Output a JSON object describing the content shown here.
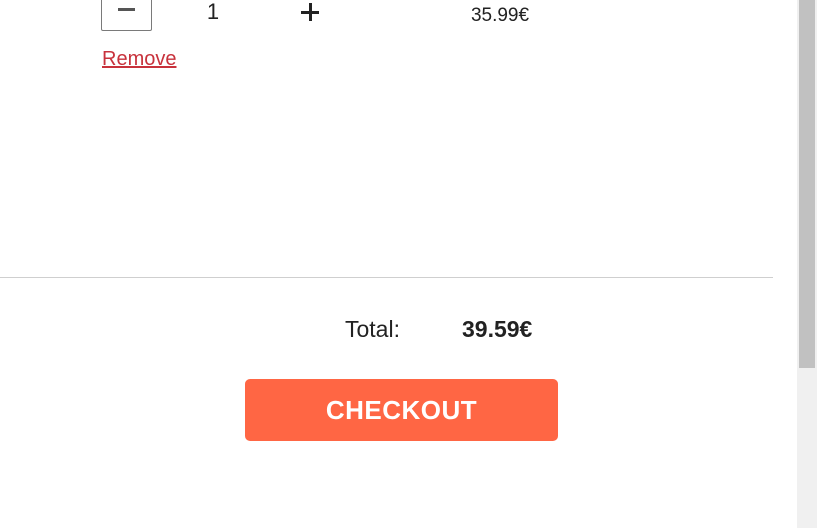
{
  "cart_item": {
    "quantity": "1",
    "price": "35.99€",
    "remove_label": "Remove"
  },
  "summary": {
    "total_label": "Total:",
    "total_value": "39.59€"
  },
  "actions": {
    "checkout_label": "CHECKOUT"
  },
  "colors": {
    "accent": "#ff6644",
    "remove_link": "#c8323c",
    "text": "#222222"
  },
  "icons": {
    "decrease": "minus-icon",
    "increase": "plus-icon"
  }
}
